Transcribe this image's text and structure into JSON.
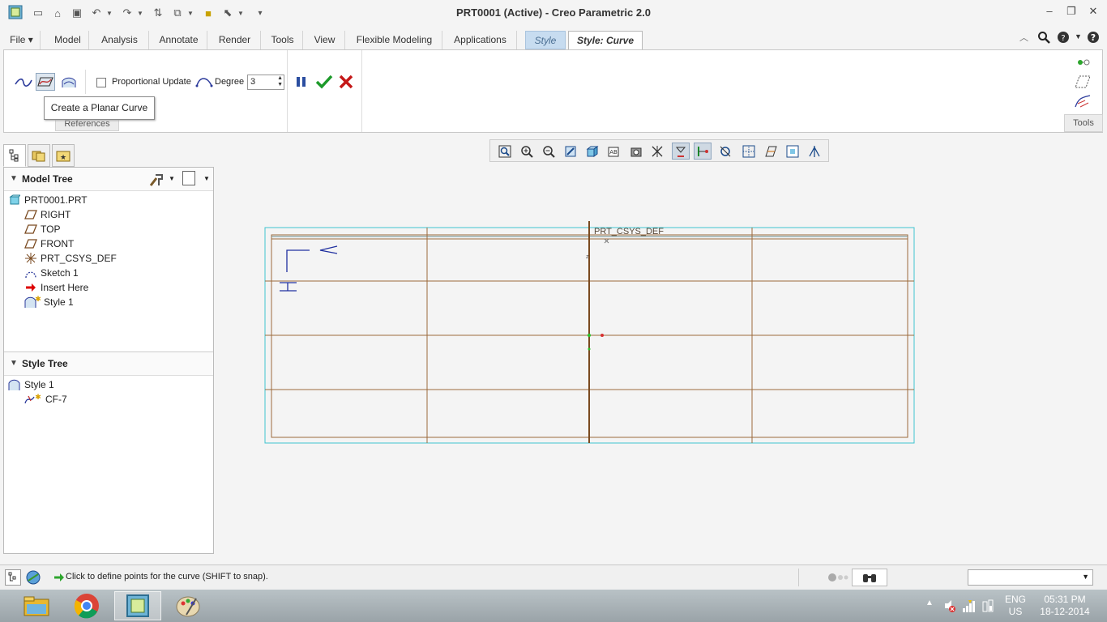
{
  "window": {
    "title": "PRT0001 (Active) - Creo Parametric 2.0"
  },
  "ribbon_tabs": [
    {
      "label": "File ▾"
    },
    {
      "label": "Model"
    },
    {
      "label": "Analysis"
    },
    {
      "label": "Annotate"
    },
    {
      "label": "Render"
    },
    {
      "label": "Tools"
    },
    {
      "label": "View"
    },
    {
      "label": "Flexible Modeling"
    },
    {
      "label": "Applications"
    },
    {
      "label": "Style"
    },
    {
      "label": "Style: Curve"
    }
  ],
  "curve_options": {
    "proportional_update_label": "Proportional Update",
    "proportional_update_checked": false,
    "degree_label": "Degree",
    "degree_value": "3",
    "references_label": "References",
    "tooltip": "Create a Planar Curve"
  },
  "tools_group": {
    "label": "Tools"
  },
  "model_tree": {
    "header": "Model Tree",
    "root": "PRT0001.PRT",
    "items": [
      {
        "label": "RIGHT",
        "icon": "datum-plane-icon"
      },
      {
        "label": "TOP",
        "icon": "datum-plane-icon"
      },
      {
        "label": "FRONT",
        "icon": "datum-plane-icon"
      },
      {
        "label": "PRT_CSYS_DEF",
        "icon": "csys-icon"
      },
      {
        "label": "Sketch 1",
        "icon": "sketch-icon"
      },
      {
        "label": "Insert Here",
        "icon": "insert-arrow-icon"
      },
      {
        "label": "Style 1",
        "icon": "style-feature-icon"
      }
    ]
  },
  "style_tree": {
    "header": "Style Tree",
    "root": "Style 1",
    "items": [
      {
        "label": "CF-7",
        "icon": "curve-icon"
      }
    ]
  },
  "graphics": {
    "csys_label": "PRT_CSYS_DEF"
  },
  "status": {
    "message": "Click to define points for the curve (SHIFT to snap)."
  },
  "taskbar": {
    "lang": "ENG",
    "region": "US",
    "time": "05:31 PM",
    "date": "18-12-2014"
  },
  "colors": {
    "style_tab": "#c7dcf0",
    "datum_line": "#9b6a3c",
    "frame": "#3fc4cf"
  }
}
